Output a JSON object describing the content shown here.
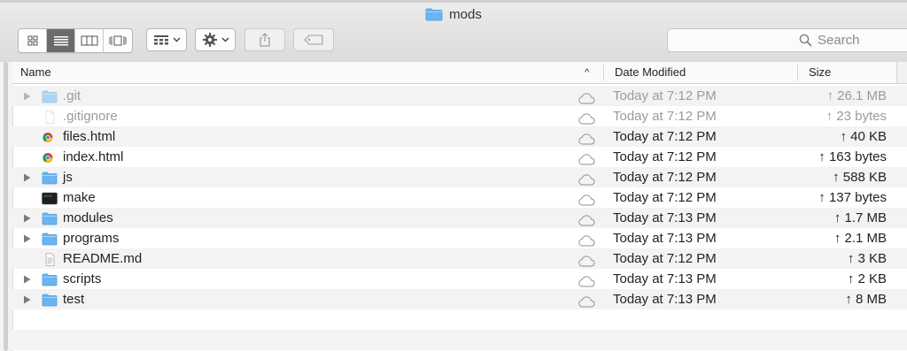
{
  "window": {
    "title": "mods",
    "folder_color": "#6ab4f1"
  },
  "toolbar": {
    "view_buttons": [
      {
        "icon": "icon-view-icon",
        "active": false
      },
      {
        "icon": "list-view-icon",
        "active": true
      },
      {
        "icon": "column-view-icon",
        "active": false
      },
      {
        "icon": "cover-flow-view-icon",
        "active": false
      }
    ],
    "arrange_icon": "arrange-grid-icon",
    "action_icon": "gear-icon",
    "share_icon": "share-icon",
    "tag_icon": "tag-icon",
    "search_placeholder": "Search"
  },
  "columns": {
    "name": "Name",
    "date": "Date Modified",
    "size": "Size",
    "sort_indicator": "^"
  },
  "files": [
    {
      "name": ".git",
      "type": "folder",
      "expandable": true,
      "dim": true,
      "date": "Today at 7:12 PM",
      "size": "↑ 26.1 MB"
    },
    {
      "name": ".gitignore",
      "type": "document",
      "expandable": false,
      "dim": true,
      "date": "Today at 7:12 PM",
      "size": "↑ 23 bytes"
    },
    {
      "name": "files.html",
      "type": "html",
      "expandable": false,
      "dim": false,
      "date": "Today at 7:12 PM",
      "size": "↑ 40 KB"
    },
    {
      "name": "index.html",
      "type": "html",
      "expandable": false,
      "dim": false,
      "date": "Today at 7:12 PM",
      "size": "↑ 163 bytes"
    },
    {
      "name": "js",
      "type": "folder",
      "expandable": true,
      "dim": false,
      "date": "Today at 7:12 PM",
      "size": "↑ 588 KB"
    },
    {
      "name": "make",
      "type": "executable",
      "expandable": false,
      "dim": false,
      "date": "Today at 7:12 PM",
      "size": "↑ 137 bytes"
    },
    {
      "name": "modules",
      "type": "folder",
      "expandable": true,
      "dim": false,
      "date": "Today at 7:13 PM",
      "size": "↑ 1.7 MB"
    },
    {
      "name": "programs",
      "type": "folder",
      "expandable": true,
      "dim": false,
      "date": "Today at 7:13 PM",
      "size": "↑ 2.1 MB"
    },
    {
      "name": "README.md",
      "type": "text",
      "expandable": false,
      "dim": false,
      "date": "Today at 7:12 PM",
      "size": "↑ 3 KB"
    },
    {
      "name": "scripts",
      "type": "folder",
      "expandable": true,
      "dim": false,
      "date": "Today at 7:13 PM",
      "size": "↑ 2 KB"
    },
    {
      "name": "test",
      "type": "folder",
      "expandable": true,
      "dim": false,
      "date": "Today at 7:13 PM",
      "size": "↑ 8 MB"
    }
  ]
}
